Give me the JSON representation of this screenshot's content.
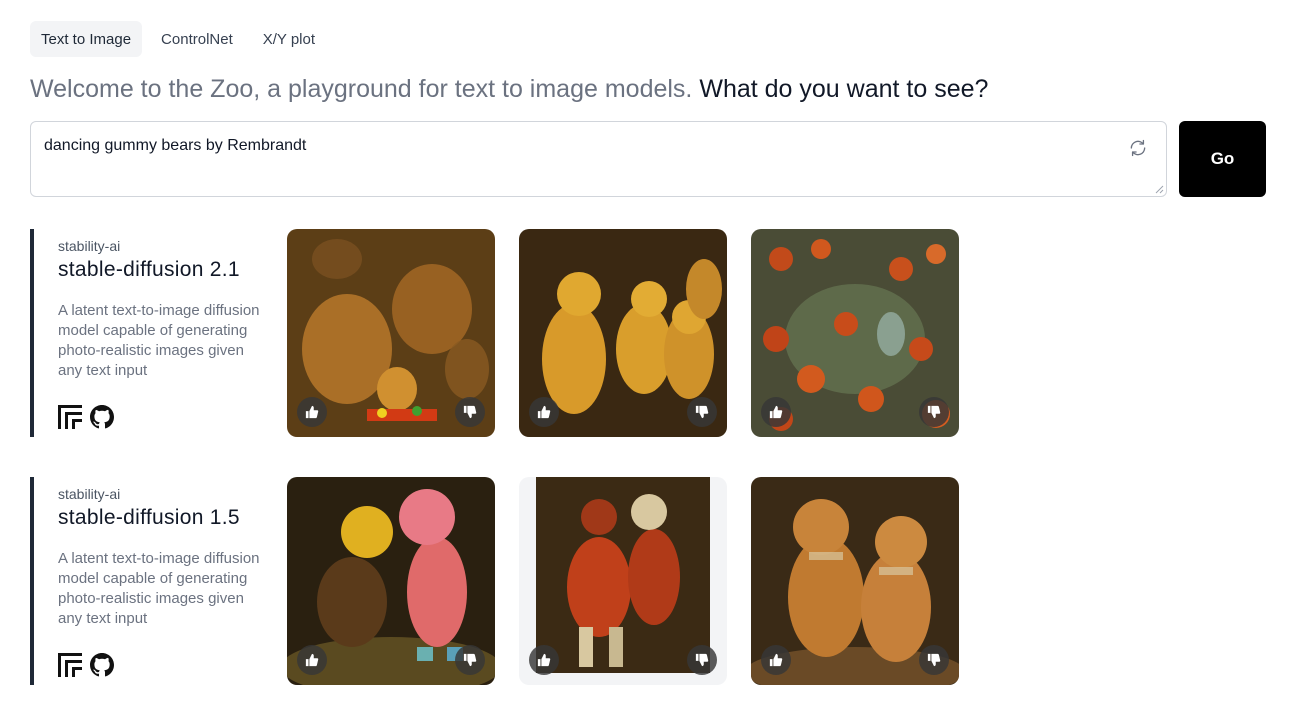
{
  "tabs": [
    {
      "label": "Text to Image",
      "active": true
    },
    {
      "label": "ControlNet",
      "active": false
    },
    {
      "label": "X/Y plot",
      "active": false
    }
  ],
  "headline": {
    "intro": "Welcome to the Zoo, a playground for text to image models.",
    "question": "What do you want to see?"
  },
  "prompt": {
    "value": "dancing gummy bears by Rembrandt",
    "go_label": "Go"
  },
  "models": [
    {
      "org": "stability-ai",
      "name": "stable-diffusion 2.1",
      "description": "A latent text-to-image diffusion model capable of generating photo-realistic images given any text input",
      "images": [
        {
          "bg": "#6b4a1c",
          "fg": "#c98a2a",
          "accent": "#e04a1a"
        },
        {
          "bg": "#3e2c14",
          "fg": "#d69a2a",
          "accent": "#e6b040"
        },
        {
          "bg": "#4d4f3a",
          "fg": "#c9501c",
          "accent": "#e06a2a"
        }
      ]
    },
    {
      "org": "stability-ai",
      "name": "stable-diffusion 1.5",
      "description": "A latent text-to-image diffusion model capable of generating photo-realistic images given any text input",
      "images": [
        {
          "bg": "#2a2010",
          "fg": "#e0b020",
          "accent": "#e06a7a"
        },
        {
          "bg": "#3b2a14",
          "fg": "#c0401a",
          "accent": "#e0d0a0"
        },
        {
          "bg": "#3a2a16",
          "fg": "#c07a30",
          "accent": "#d8a860"
        }
      ]
    }
  ],
  "icons": {
    "refresh": "refresh-icon",
    "thumbs_up": "thumbs-up-icon",
    "thumbs_down": "thumbs-down-icon",
    "replicate": "replicate-icon",
    "github": "github-icon"
  }
}
